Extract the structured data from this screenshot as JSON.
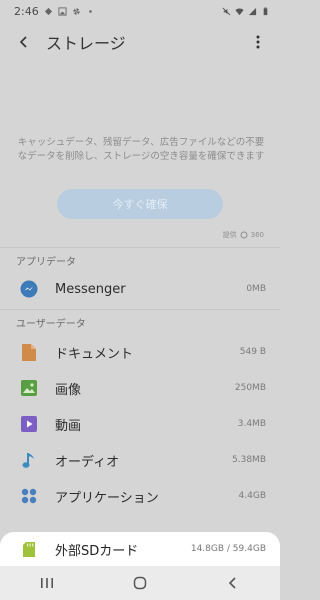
{
  "status_bar": {
    "time": "2:46"
  },
  "header": {
    "title": "ストレージ"
  },
  "description": "キャッシュデータ、残留データ、広告ファイルなどの不要なデータを削除し、ストレージの空き容量を確保できます",
  "clean_button": {
    "label": "今すぐ確保"
  },
  "powered_by": {
    "prefix": "提供",
    "brand": "360"
  },
  "app_data": {
    "title": "アプリデータ",
    "items": [
      {
        "label": "Messenger",
        "size": "0MB",
        "icon": "messenger-icon"
      }
    ]
  },
  "user_data": {
    "title": "ユーザーデータ",
    "items": [
      {
        "label": "ドキュメント",
        "size": "549 B",
        "icon": "document-icon"
      },
      {
        "label": "画像",
        "size": "250MB",
        "icon": "image-icon"
      },
      {
        "label": "動画",
        "size": "3.4MB",
        "icon": "video-icon"
      },
      {
        "label": "オーディオ",
        "size": "5.38MB",
        "icon": "audio-icon"
      },
      {
        "label": "アプリケーション",
        "size": "4.4GB",
        "icon": "apps-icon"
      }
    ]
  },
  "sd_card": {
    "label": "外部SDカード",
    "size": "14.8GB / 59.4GB",
    "icon": "sd-card-icon"
  },
  "colors": {
    "accent_blue": "#3d7ab8",
    "document": "#d08a4a",
    "image": "#5a9e44",
    "video": "#7b5fc4",
    "audio": "#3a8cbf",
    "apps": "#4a7fbf",
    "sd_card": "#9ec23a"
  }
}
